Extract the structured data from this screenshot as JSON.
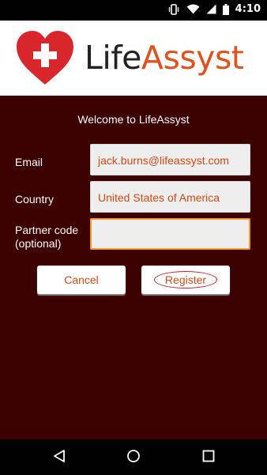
{
  "status_bar": {
    "time": "4:10",
    "icons": [
      "vibrate-icon",
      "wifi-icon",
      "signal-icon",
      "battery-icon"
    ]
  },
  "header": {
    "brand_part1": "Life",
    "brand_part2": "Assyst",
    "brand_color": "#e0521c",
    "logo_color": "#d8262c"
  },
  "form": {
    "welcome": "Welcome to LifeAssyst",
    "email_label": "Email",
    "email_value": "jack.burns@lifeassyst.com",
    "country_label": "Country",
    "country_value": "United States of America",
    "partner_label_line1": "Partner code",
    "partner_label_line2": "(optional)",
    "partner_value": ""
  },
  "buttons": {
    "cancel": "Cancel",
    "register": "Register"
  },
  "nav": {
    "icons": [
      "back-icon",
      "home-icon",
      "recents-icon"
    ]
  },
  "colors": {
    "background": "#3c0000",
    "accent_text": "#d04a12",
    "focus_border": "#f09b30"
  }
}
